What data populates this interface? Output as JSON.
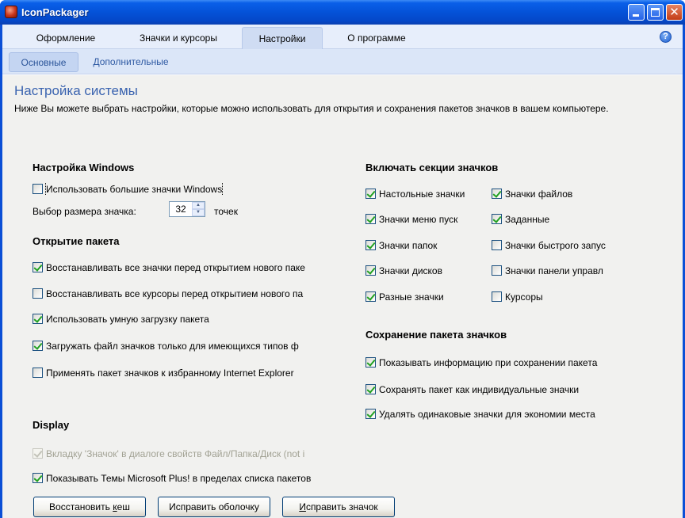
{
  "window": {
    "title": "IconPackager"
  },
  "tabs": [
    {
      "label": "Оформление",
      "active": false
    },
    {
      "label": "Значки и курсоры",
      "active": false
    },
    {
      "label": "Настройки",
      "active": true
    },
    {
      "label": "О программе",
      "active": false
    }
  ],
  "subtabs": [
    {
      "label": "Основные",
      "active": true
    },
    {
      "label": "Дополнительные",
      "active": false
    }
  ],
  "page": {
    "title": "Настройка системы",
    "description": "Ниже Вы можете выбрать настройки, которые можно использовать для открытия и сохранения пакетов значков в вашем компьютере."
  },
  "windows_settings": {
    "heading": "Настройка Windows",
    "large_icons": {
      "label": "Использовать большие значки Windows",
      "checked": false
    },
    "icon_size": {
      "label": "Выбор размера значка:",
      "value": "32",
      "unit": "точек"
    }
  },
  "open_package": {
    "heading": "Открытие пакета",
    "items": [
      {
        "label": "Восстанавливать все значки перед открытием нового паке",
        "checked": true
      },
      {
        "label": "Восстанавливать все курсоры перед открытием нового па",
        "checked": false
      },
      {
        "label": "Использовать умную загрузку пакета",
        "checked": true
      },
      {
        "label": "Загружать файл значков только для имеющихся типов ф",
        "checked": true
      },
      {
        "label": "Применять пакет значков к избранному Internet Explorer",
        "checked": false
      }
    ]
  },
  "display": {
    "heading": "Display",
    "items": [
      {
        "label": "Вкладку 'Значок' в диалоге свойств Файл/Папка/Диск (not i",
        "checked": true,
        "disabled": true
      },
      {
        "label": "Показывать Темы Microsoft Plus! в пределах списка пакетов",
        "checked": true,
        "disabled": false
      }
    ]
  },
  "icon_sections": {
    "heading": "Включать секции значков",
    "col1": [
      {
        "label": "Настольные значки",
        "checked": true
      },
      {
        "label": "Значки меню пуск",
        "checked": true
      },
      {
        "label": "Значки папок",
        "checked": true
      },
      {
        "label": "Значки дисков",
        "checked": true
      },
      {
        "label": "Разные значки",
        "checked": true
      }
    ],
    "col2": [
      {
        "label": "Значки файлов",
        "checked": true
      },
      {
        "label": "Заданные",
        "checked": true
      },
      {
        "label": "Значки быстрого запус",
        "checked": false
      },
      {
        "label": "Значки панели управл",
        "checked": false
      },
      {
        "label": "Курсоры",
        "checked": false
      }
    ]
  },
  "save_package": {
    "heading": "Сохранение пакета значков",
    "items": [
      {
        "label": "Показывать информацию при сохранении пакета",
        "checked": true
      },
      {
        "label": "Сохранять пакет как индивидуальные значки",
        "checked": true
      },
      {
        "label": "Удалять одинаковые значки для экономии места",
        "checked": true
      }
    ]
  },
  "buttons": {
    "restore_cache": {
      "pre": "Восстановить ",
      "accel": "к",
      "post": "еш"
    },
    "fix_shell": {
      "pre": "Исправить оболочку",
      "accel": "",
      "post": ""
    },
    "fix_icon": {
      "pre": "",
      "accel": "И",
      "post": "справить значок"
    }
  }
}
